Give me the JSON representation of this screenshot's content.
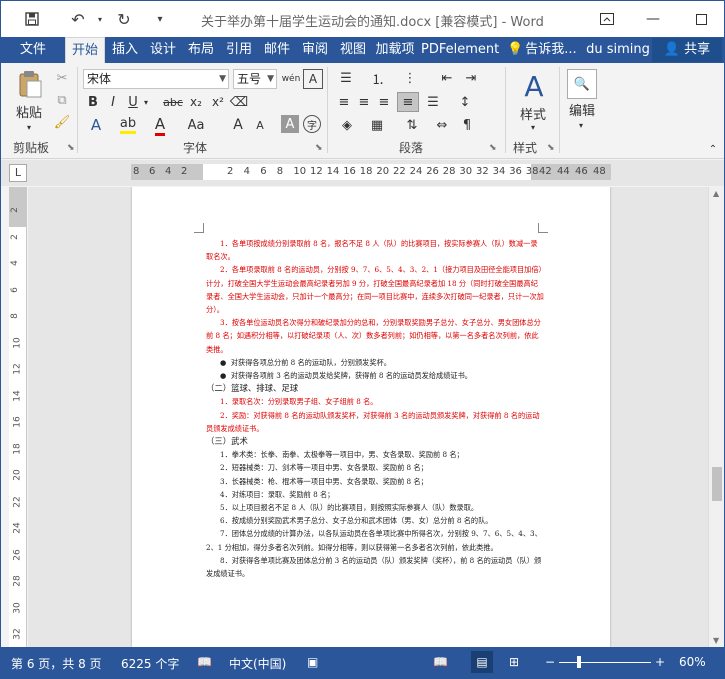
{
  "window": {
    "title": "关于举办第十届学生运动会的通知.docx [兼容模式] - Word"
  },
  "tabs": {
    "file": "文件",
    "items": [
      "开始",
      "插入",
      "设计",
      "布局",
      "引用",
      "邮件",
      "审阅",
      "视图",
      "加载项",
      "PDFelement"
    ],
    "tell_me": "告诉我...",
    "user": "du siming",
    "share": "共享"
  },
  "ribbon": {
    "clipboard": {
      "paste": "粘贴",
      "label": "剪贴板"
    },
    "font": {
      "name": "宋体",
      "size": "五号",
      "label": "字体"
    },
    "paragraph": {
      "label": "段落"
    },
    "styles": {
      "button": "样式",
      "label": "样式"
    },
    "editing": {
      "button": "编辑"
    }
  },
  "ruler": {
    "left": [
      "8",
      "6",
      "4",
      "2"
    ],
    "middle": [
      "2",
      "4",
      "6",
      "8",
      "10",
      "12",
      "14",
      "16",
      "18",
      "20",
      "22",
      "24",
      "26",
      "28",
      "30",
      "32",
      "34",
      "36",
      "38"
    ],
    "right": [
      "42",
      "44",
      "46",
      "48"
    ],
    "vertical": [
      "2",
      "2",
      "4",
      "6",
      "8",
      "10",
      "12",
      "14",
      "16",
      "18",
      "20",
      "22",
      "24",
      "26",
      "28",
      "30",
      "32"
    ]
  },
  "document": {
    "red_list_1": [
      "1．各单项按成绩分别录取前 8 名，报名不足 8 人（队）的比赛项目，按实际参赛人（队）数减一录取名次。",
      "2．各单项录取前 8 名的运动员，分别按 9、7、6、5、4、3、2、1（接力项目及田径全能项目加倍）计分，打破全国大学生运动会最高纪录者另加 9 分，打破全国最高纪录者加 18 分（同时打破全国最高纪录者、全国大学生运动会，只加计一个最高分；在同一项目比赛中，连续多次打破同一纪录者，只计一次加分）。",
      "3．按各单位运动员名次得分和破纪录加分的总和，分别录取奖励男子总分、女子总分、男女团体总分前 8 名；如遇积分相等，以打破纪录项（人、次）数多者列前；如仍相等，以第一名多者名次列前，依此类推。"
    ],
    "bullets": [
      "对获得各项总分前 8 名的运动队，分别颁发奖杯。",
      "对获得各项前 3 名的运动员发给奖牌，获得前 8 名的运动员发给成绩证书。"
    ],
    "heading_2": "（二）篮球、排球、足球",
    "red_list_2": [
      "1．录取名次：分别录取男子组、女子组前 8 名。",
      "2．奖励：对获得前 8 名的运动队颁发奖杯，对获得前 3 名的运动员颁发奖牌，对获得前 8 名的运动员颁发成绩证书。"
    ],
    "heading_3": "（三）武术",
    "list_3": [
      "1．拳术类：长拳、南拳、太极拳等一项目中，男、女各录取、奖励前 8 名；",
      "2．短器械类：刀、剑术等一项目中男、女各录取、奖励前 8 名；",
      "3．长器械类：枪、棍术等一项目中男、女各录取、奖励前 8 名；",
      "4．对练项目：录取、奖励前 8 名；",
      "5．以上项目报名不足 8 人（队）的比赛项目，则按照实际参赛人（队）数录取。",
      "6．按成绩分别奖励武术男子总分、女子总分和武术团体（男、女）总分前 8 名的队。",
      "7．团体总分成绩的计算办法，以各队运动员在各单项比赛中所得名次，分别按 9、7、6、5、4、3、2、1 分相加，得分多者名次列前。如得分相等，则以获得第一名多者名次列前，依此类推。",
      "8．对获得各单项比赛及团体总分前 3 名的运动员（队）颁发奖牌（奖杯），前 8 名的运动员（队）颁发成绩证书。"
    ]
  },
  "status": {
    "page": "第 6 页，共 8 页",
    "words": "6225 个字",
    "language": "中文(中国)",
    "zoom": "60%"
  }
}
